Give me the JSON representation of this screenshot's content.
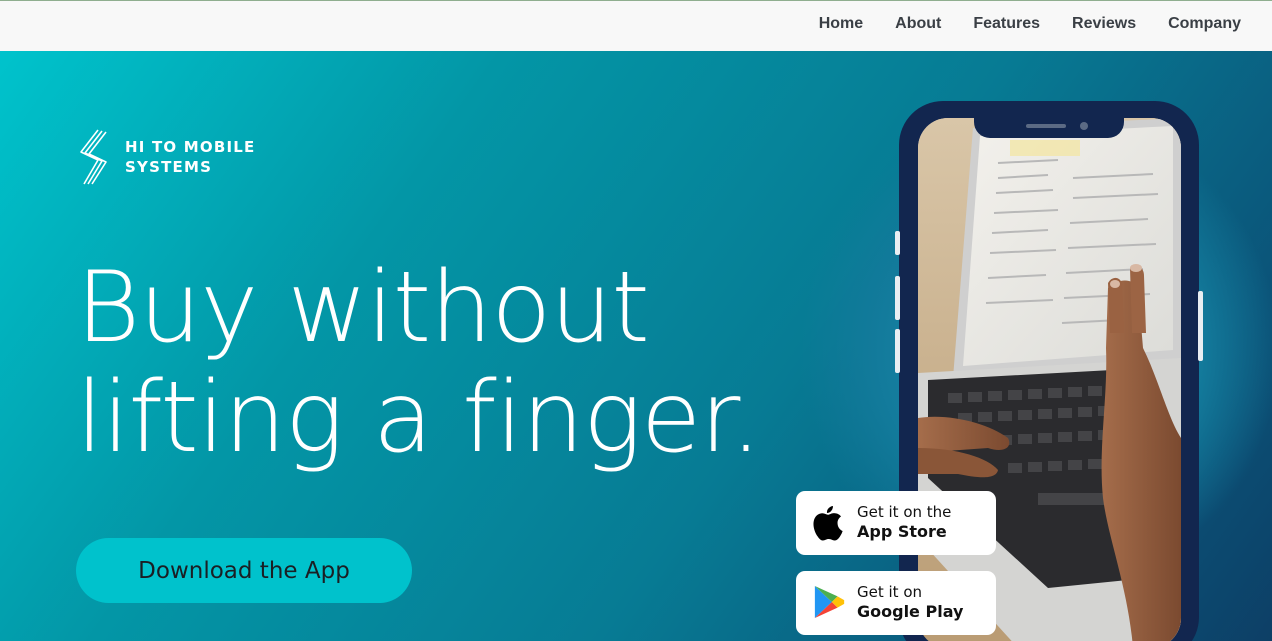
{
  "nav": {
    "items": [
      {
        "label": "Home"
      },
      {
        "label": "About"
      },
      {
        "label": "Features"
      },
      {
        "label": "Reviews"
      },
      {
        "label": "Company"
      }
    ]
  },
  "hero": {
    "logo_text": "HI TO  MOBILE\nSYSTEMS",
    "headline_line1": "Buy without",
    "headline_line2": "lifting a finger.",
    "cta_label": "Download the App"
  },
  "badges": {
    "app_store": {
      "small": "Get it on the",
      "big": "App Store",
      "icon": "apple-icon"
    },
    "google_play": {
      "small": "Get it on",
      "big": "Google Play",
      "icon": "google-play-icon"
    }
  },
  "colors": {
    "accent": "#00c2cc",
    "hero_start": "#00c3cc",
    "hero_end": "#0d3f66",
    "phone_frame": "#12264f"
  }
}
